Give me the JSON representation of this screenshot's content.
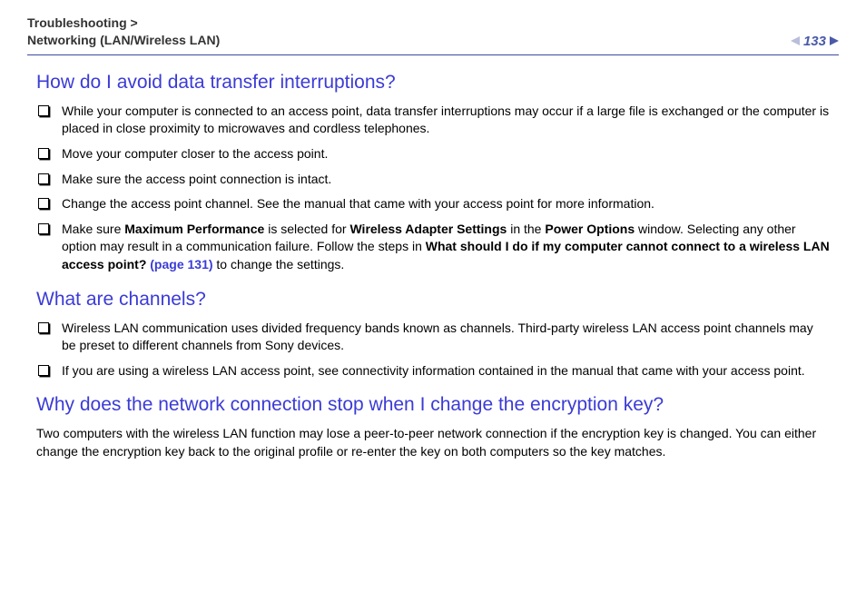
{
  "header": {
    "breadcrumb_line1": "Troubleshooting >",
    "breadcrumb_line2": "Networking (LAN/Wireless LAN)",
    "page_number": "133"
  },
  "sections": {
    "s1": {
      "title": "How do I avoid data transfer interruptions?",
      "items": {
        "i1": "While your computer is connected to an access point, data transfer interruptions may occur if a large file is exchanged or the computer is placed in close proximity to microwaves and cordless telephones.",
        "i2": "Move your computer closer to the access point.",
        "i3": "Make sure the access point connection is intact.",
        "i4": "Change the access point channel. See the manual that came with your access point for more information.",
        "i5a": "Make sure ",
        "i5b": "Maximum Performance",
        "i5c": " is selected for ",
        "i5d": "Wireless Adapter Settings",
        "i5e": " in the ",
        "i5f": "Power Options",
        "i5g": " window. Selecting any other option may result in a communication failure. Follow the steps in ",
        "i5h": "What should I do if my computer cannot connect to a wireless LAN access point?",
        "i5i": " (page 131)",
        "i5j": " to change the settings."
      }
    },
    "s2": {
      "title": "What are channels?",
      "items": {
        "i1": "Wireless LAN communication uses divided frequency bands known as channels. Third-party wireless LAN access point channels may be preset to different channels from Sony devices.",
        "i2": "If you are using a wireless LAN access point, see connectivity information contained in the manual that came with your access point."
      }
    },
    "s3": {
      "title": "Why does the network connection stop when I change the encryption key?",
      "body": "Two computers with the wireless LAN function may lose a peer-to-peer network connection if the encryption key is changed. You can either change the encryption key back to the original profile or re-enter the key on both computers so the key matches."
    }
  }
}
